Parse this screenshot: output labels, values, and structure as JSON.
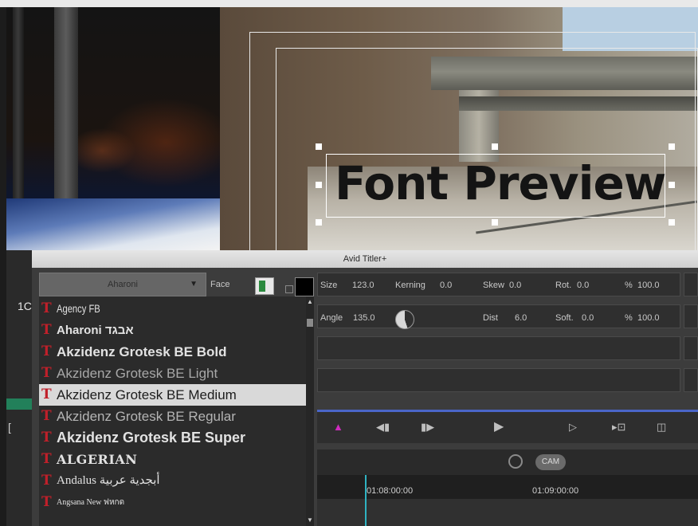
{
  "panel": {
    "title": "Avid Titler+"
  },
  "preview": {
    "text": "Font Preview"
  },
  "left_strip": {
    "timecode_fragment": "1C",
    "bracket": "["
  },
  "font_selector": {
    "value": "Aharoni",
    "face_label": "Face"
  },
  "controls": {
    "row1": [
      {
        "label": "Size",
        "value": "123.0"
      },
      {
        "label": "Kerning",
        "value": "0.0"
      },
      {
        "label": "Skew",
        "value": "0.0"
      },
      {
        "label": "Rot.",
        "value": "0.0"
      },
      {
        "label": "%",
        "value": "100.0"
      }
    ],
    "row2": [
      {
        "label": "Angle",
        "value": "135.0"
      },
      {
        "label": "Dist",
        "value": "6.0"
      },
      {
        "label": "Soft.",
        "value": "0.0"
      },
      {
        "label": "%",
        "value": "100.0"
      }
    ]
  },
  "font_list": [
    {
      "name": "Agency FB",
      "selected": false
    },
    {
      "name": "Aharoni אבגד",
      "selected": false
    },
    {
      "name": "Akzidenz Grotesk BE Bold",
      "selected": false
    },
    {
      "name": "Akzidenz Grotesk BE Light",
      "selected": false
    },
    {
      "name": "Akzidenz Grotesk BE Medium",
      "selected": true
    },
    {
      "name": "Akzidenz Grotesk BE Regular",
      "selected": false
    },
    {
      "name": "Akzidenz Grotesk BE Super",
      "selected": false
    },
    {
      "name": "ALGERIAN",
      "selected": false
    },
    {
      "name": "Andalus أبجدية عربية",
      "selected": false
    },
    {
      "name": "Angsana New ฟหกด",
      "selected": false
    }
  ],
  "timeline": {
    "timecodes": [
      "01:08:00:00",
      "01:09:00:00"
    ],
    "cam_label": "CAM"
  },
  "colors": {
    "accent_blue": "#4a66c8",
    "playhead": "#2fb3c2",
    "font_icon": "#c0202a",
    "marker": "#d02bbf"
  }
}
